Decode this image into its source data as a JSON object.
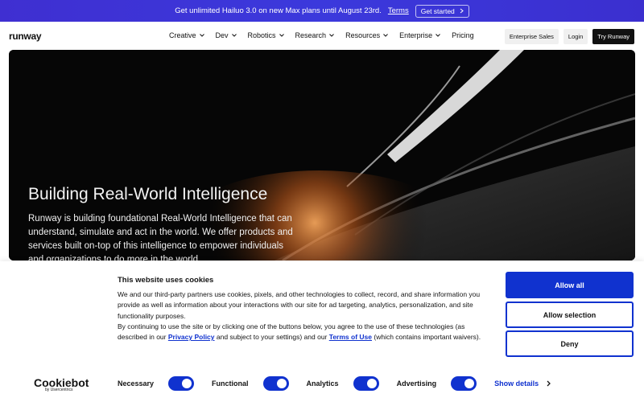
{
  "promo": {
    "text": "Get unlimited Hailuo 3.0 on new Max plans until August 23rd.",
    "terms": "Terms",
    "cta": "Get started",
    "cta_icon": "chevron-right-icon"
  },
  "nav": {
    "logo": "runway",
    "menu": [
      "Creative",
      "Dev",
      "Robotics",
      "Research",
      "Resources",
      "Enterprise",
      "Pricing"
    ],
    "enterprise_sales": "Enterprise Sales",
    "login": "Login",
    "try": "Try Runway"
  },
  "hero": {
    "title": "Building Real-World Intelligence",
    "text": "Runway is building foundational Real-World Intelligence that can understand, simulate and act in the world. We offer products and services built on-top of this intelligence to empower individuals and organizations to do more in the world."
  },
  "cookie": {
    "title": "This website uses cookies",
    "p1": "We and our third-party partners use cookies, pixels, and other technologies to collect, record, and share information you provide as well as information about your interactions with our site for ad targeting, analytics, personalization, and site functionality purposes.",
    "p2_a": "By continuing to use the site or by clicking one of the buttons below, you agree to the use of these technologies (as described in our",
    "privacy_link": "Privacy Policy",
    "p2_b": "and subject to your settings) and our",
    "terms_link": "Terms of Use",
    "p2_c": "(which contains important waivers).",
    "allow_all": "Allow all",
    "allow_selection": "Allow selection",
    "deny": "Deny",
    "brand": "Cookiebot",
    "brand_sub": "by Usercentrics",
    "toggles": [
      "Necessary",
      "Functional",
      "Analytics",
      "Advertising"
    ],
    "show_details": "Show details",
    "accent": "#1032cf"
  }
}
